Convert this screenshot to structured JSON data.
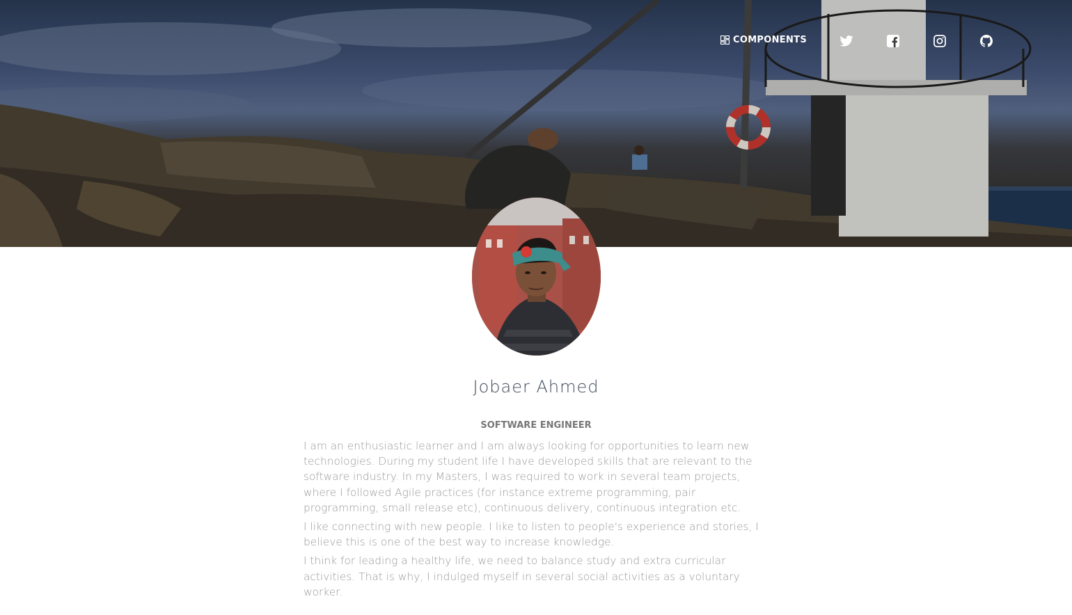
{
  "navbar": {
    "components_label": "COMPONENTS",
    "components_icon": "dashboard-grid-icon",
    "social_icons": [
      "twitter-icon",
      "facebook-icon",
      "instagram-icon",
      "github-icon"
    ]
  },
  "profile": {
    "name": "Jobaer Ahmed",
    "title": "SOFTWARE ENGINEER",
    "bio": [
      "I am an enthusiastic learner and I am always looking for opportunities to learn new technologies. During my student life I have developed skills that are relevant to the software industry. In my Masters, I was required to work in several team projects, where I followed Agile practices (for instance extreme programming, pair programming, small release etc), continuous delivery, continuous integration etc.",
      "I like connecting with new people. I like to listen to people's experience and stories, I believe this is one of the best way to increase knowledge.",
      "I think for leading a healthy life, we need to balance study and extra curricular activities. That is why, I indulged myself in several social activities as a voluntary worker."
    ]
  },
  "colors": {
    "name_text": "#3c4858",
    "title_text": "#777777",
    "bio_text": "#999999",
    "nav_text": "#ffffff"
  }
}
